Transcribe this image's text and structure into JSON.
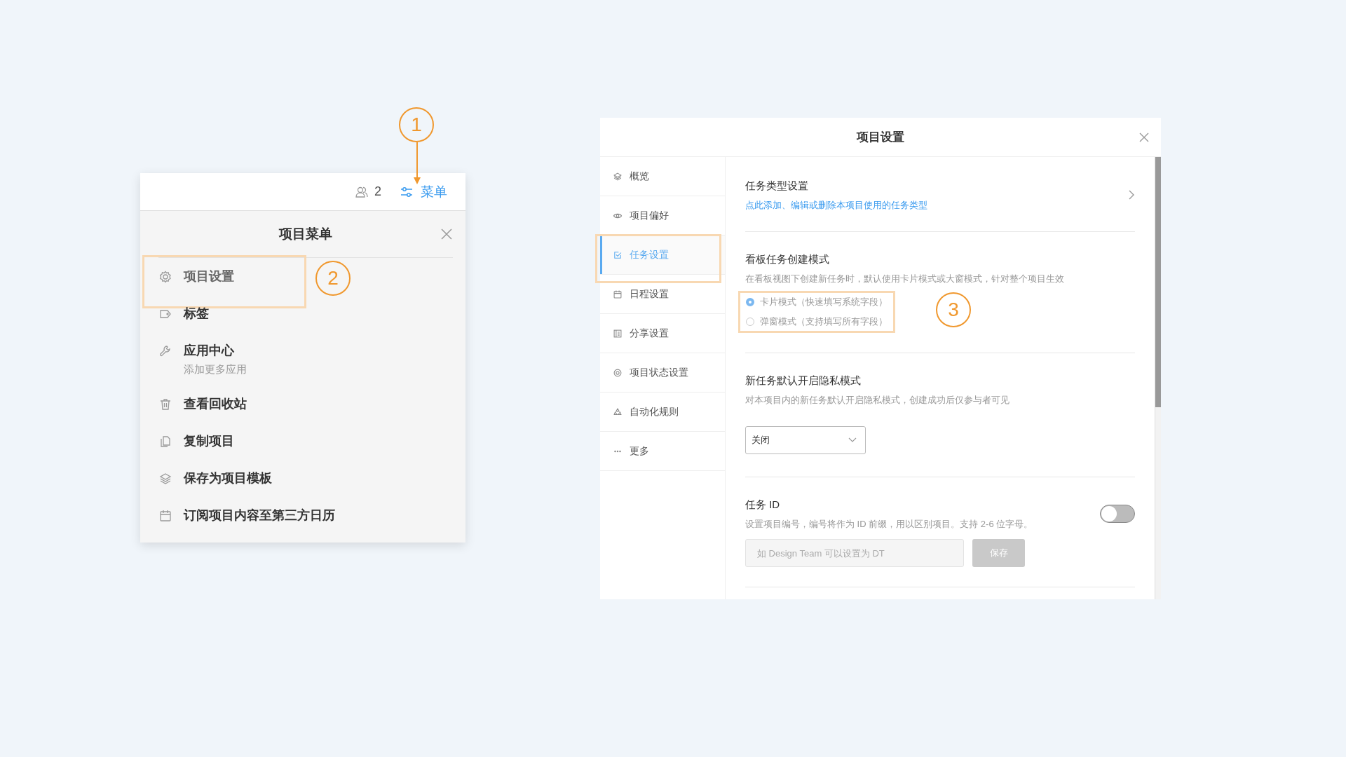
{
  "menu_panel": {
    "member_count": "2",
    "menu_button": "菜单",
    "menu_callout": "1",
    "title": "项目菜单",
    "items": [
      {
        "label": "项目设置",
        "highlighted": true,
        "callout": "2"
      },
      {
        "label": "标签",
        "highlighted": false
      },
      {
        "label": "应用中心",
        "sublabel": "添加更多应用",
        "highlighted": false
      },
      {
        "label": "查看回收站",
        "highlighted": false
      },
      {
        "label": "复制项目",
        "highlighted": false
      },
      {
        "label": "保存为项目模板",
        "highlighted": false
      },
      {
        "label": "订阅项目内容至第三方日历",
        "highlighted": false
      }
    ]
  },
  "settings_panel": {
    "title": "项目设置",
    "nav": [
      {
        "label": "概览",
        "selected": false,
        "highlighted": false
      },
      {
        "label": "项目偏好",
        "selected": false,
        "highlighted": false
      },
      {
        "label": "任务设置",
        "selected": true,
        "highlighted": true
      },
      {
        "label": "日程设置",
        "selected": false,
        "highlighted": false
      },
      {
        "label": "分享设置",
        "selected": false,
        "highlighted": false
      },
      {
        "label": "项目状态设置",
        "selected": false,
        "highlighted": false
      },
      {
        "label": "自动化规则",
        "selected": false,
        "highlighted": false
      },
      {
        "label": "更多",
        "selected": false,
        "highlighted": false
      }
    ],
    "sections": [
      {
        "kind": "link",
        "title": "任务类型设置",
        "link": "点此添加、编辑或删除本项目使用的任务类型"
      },
      {
        "kind": "radio",
        "title": "看板任务创建模式",
        "description": "在看板视图下创建新任务时，默认使用卡片模式或大窗模式，针对整个项目生效",
        "highlighted": true,
        "callout": "3",
        "options": [
          {
            "label": "卡片模式（快速填写系统字段）",
            "selected": true
          },
          {
            "label": "弹窗模式（支持填写所有字段）",
            "selected": false
          }
        ]
      },
      {
        "kind": "select",
        "title": "新任务默认开启隐私模式",
        "description": "对本项目内的新任务默认开启隐私模式，创建成功后仅参与者可见",
        "value": "关闭"
      },
      {
        "kind": "toggle",
        "title": "任务 ID",
        "description": "设置项目编号，编号将作为 ID 前缀，用以区别项目。支持 2-6 位字母。",
        "on": false,
        "placeholder": "如 Design Team 可以设置为 DT",
        "button": "保存"
      }
    ]
  }
}
